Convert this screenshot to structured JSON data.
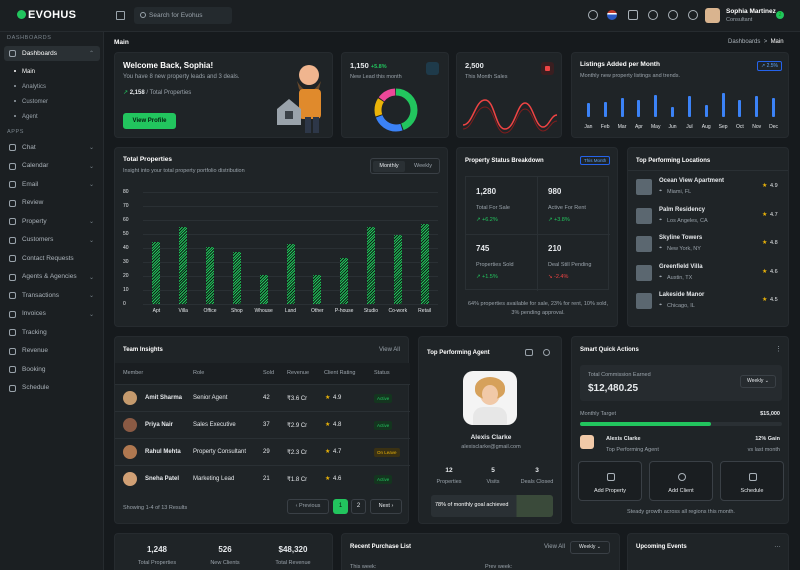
{
  "brand": {
    "name": "EVOHUS"
  },
  "search": {
    "placeholder": "Search for Evohus"
  },
  "user": {
    "name": "Sophia Martinez",
    "role": "Consultant",
    "badge": "2"
  },
  "sidebar": {
    "section_dashboards": "DASHBOARDS",
    "section_apps": "APPS",
    "dashboards": {
      "label": "Dashboards",
      "subs": [
        "Main",
        "Analytics",
        "Customer",
        "Agent"
      ]
    },
    "apps": [
      "Chat",
      "Calendar",
      "Email",
      "Review",
      "Property",
      "Customers",
      "Contact Requests",
      "Agents & Agencies",
      "Transactions",
      "Invoices",
      "Tracking",
      "Revenue",
      "Booking",
      "Schedule"
    ]
  },
  "breadcrumb": {
    "title": "Main",
    "parent": "Dashboards",
    "sep": ">",
    "current": "Main"
  },
  "welcome": {
    "title": "Welcome Back, Sophia!",
    "subtitle": "You have 8 new property leads and 3 deals.",
    "count": "2,158",
    "count_label": "/ Total Properties",
    "button": "View Profile"
  },
  "leads": {
    "value": "1,150",
    "delta": "+5.8%",
    "label": "New Lead this month",
    "donut": [
      {
        "value": 45,
        "color": "#22c55e"
      },
      {
        "value": 25,
        "color": "#3b82f6"
      },
      {
        "value": 15,
        "color": "#eab308"
      },
      {
        "value": 15,
        "color": "#ec4899"
      }
    ]
  },
  "sales": {
    "value": "2,500",
    "label": "This Month Sales"
  },
  "listings": {
    "title": "Listings Added per Month",
    "subtitle": "Monthly new property listings and trends.",
    "badge": "2.5%",
    "months": [
      "Jan",
      "Feb",
      "Mar",
      "Apr",
      "May",
      "Jun",
      "Jul",
      "Aug",
      "Sep",
      "Oct",
      "Nov",
      "Dec"
    ],
    "values": [
      8,
      9,
      11,
      10,
      13,
      6,
      12,
      7,
      14,
      10,
      12,
      11
    ]
  },
  "total_properties": {
    "title": "Total Properties",
    "subtitle": "Insight into your total property portfolio distribution",
    "tabs": [
      "Monthly",
      "Weekly"
    ],
    "yticks": [
      "80",
      "70",
      "60",
      "50",
      "40",
      "30",
      "20",
      "10",
      "0"
    ]
  },
  "chart_data": {
    "type": "bar",
    "categories": [
      "Apt",
      "Villa",
      "Office",
      "Shop",
      "Whouse",
      "Land",
      "Other",
      "P-house",
      "Studio",
      "Co-work",
      "Retail"
    ],
    "values": [
      44,
      55,
      41,
      37,
      21,
      43,
      21,
      33,
      55,
      49,
      57
    ],
    "ylim": [
      0,
      80
    ],
    "xlabel": "",
    "ylabel": ""
  },
  "status": {
    "title": "Property Status Breakdown",
    "badge": "This Month",
    "cells": [
      {
        "value": "1,280",
        "label": "Total For Sale",
        "delta": "+6.2%",
        "dir": "up"
      },
      {
        "value": "980",
        "label": "Active For Rent",
        "delta": "+3.8%",
        "dir": "up"
      },
      {
        "value": "745",
        "label": "Properties Sold",
        "delta": "+1.5%",
        "dir": "up"
      },
      {
        "value": "210",
        "label": "Deal Still Pending",
        "delta": "-2.4%",
        "dir": "down"
      }
    ],
    "footer": "64% properties available for sale, 23% for rent, 10% sold, 3% pending approval."
  },
  "locations": {
    "title": "Top Performing Locations",
    "items": [
      {
        "name": "Ocean View Apartment",
        "city": "Miami, FL",
        "rating": "4.9"
      },
      {
        "name": "Palm Residency",
        "city": "Los Angeles, CA",
        "rating": "4.7"
      },
      {
        "name": "Skyline Towers",
        "city": "New York, NY",
        "rating": "4.8"
      },
      {
        "name": "Greenfield Villa",
        "city": "Austin, TX",
        "rating": "4.6"
      },
      {
        "name": "Lakeside Manor",
        "city": "Chicago, IL",
        "rating": "4.5"
      }
    ]
  },
  "team": {
    "title": "Team Insights",
    "view_all": "View All",
    "headers": [
      "Member",
      "Role",
      "Sold",
      "Revenue",
      "Client Rating",
      "Status"
    ],
    "rows": [
      {
        "member": "Amit Sharma",
        "role": "Senior Agent",
        "sold": "42",
        "revenue": "₹3.6 Cr",
        "rating": "4.9",
        "status": "Active"
      },
      {
        "member": "Priya Nair",
        "role": "Sales Executive",
        "sold": "37",
        "revenue": "₹2.9 Cr",
        "rating": "4.8",
        "status": "Active"
      },
      {
        "member": "Rahul Mehta",
        "role": "Property Consultant",
        "sold": "29",
        "revenue": "₹2.3 Cr",
        "rating": "4.7",
        "status": "On Leave"
      },
      {
        "member": "Sneha Patel",
        "role": "Marketing Lead",
        "sold": "21",
        "revenue": "₹1.8 Cr",
        "rating": "4.6",
        "status": "Active"
      }
    ],
    "showing": "Showing 1-4 of 13 Results",
    "prev": "Previous",
    "pages": [
      "1",
      "2"
    ],
    "next": "Next"
  },
  "agent": {
    "title": "Top Performing Agent",
    "name": "Alexis Clarke",
    "email": "alexisclarke@gmail.com",
    "stats": [
      {
        "value": "12",
        "label": "Properties"
      },
      {
        "value": "5",
        "label": "Visits"
      },
      {
        "value": "3",
        "label": "Deals Closed"
      }
    ],
    "goal": "78% of monthly goal achieved"
  },
  "quick": {
    "title": "Smart Quick Actions",
    "commission_label": "Total Commission Earned",
    "commission": "$12,480.25",
    "period": "Weekly",
    "target_label": "Monthly Target",
    "target_value": "$15,000",
    "progress": 0.65,
    "agent_name": "Alexis Clarke",
    "agent_role": "Top Performing Agent",
    "gain": "12% Gain",
    "gain_sub": "vs last month",
    "actions": [
      "Add Property",
      "Add Client",
      "Schedule"
    ],
    "footer": "Steady growth across all regions this month."
  },
  "bottom": {
    "stats": [
      {
        "value": "1,248",
        "label": "Total Properties"
      },
      {
        "value": "526",
        "label": "New Clients"
      },
      {
        "value": "$48,320",
        "label": "Total Revenue"
      }
    ],
    "purchase_title": "Recent Purchase List",
    "purchase_view": "View All",
    "purchase_period": "Weekly",
    "this_week": "This week:",
    "prev_week": "Prev week:",
    "events_title": "Upcoming Events"
  }
}
